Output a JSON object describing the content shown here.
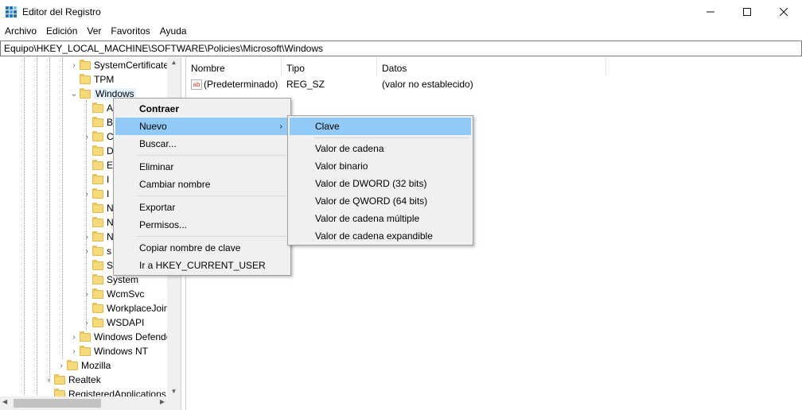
{
  "window": {
    "title": "Editor del Registro",
    "minimize_icon": "minimize-icon",
    "maximize_icon": "maximize-icon",
    "close_icon": "close-icon"
  },
  "menu": [
    "Archivo",
    "Edición",
    "Ver",
    "Favoritos",
    "Ayuda"
  ],
  "address": "Equipo\\HKEY_LOCAL_MACHINE\\SOFTWARE\\Policies\\Microsoft\\Windows",
  "tree": {
    "items": [
      {
        "label": "SystemCertificates",
        "expandable": true
      },
      {
        "label": "TPM",
        "expandable": false
      },
      {
        "label": "Windows",
        "expandable": true,
        "expanded": true,
        "selected": true
      },
      {
        "label": "A",
        "expandable": false
      },
      {
        "label": "B",
        "expandable": false
      },
      {
        "label": "C",
        "expandable": true
      },
      {
        "label": "D",
        "expandable": false
      },
      {
        "label": "E",
        "expandable": false
      },
      {
        "label": "I",
        "expandable": false
      },
      {
        "label": "I",
        "expandable": true
      },
      {
        "label": "N",
        "expandable": false
      },
      {
        "label": "N",
        "expandable": false
      },
      {
        "label": "N",
        "expandable": true
      },
      {
        "label": "s",
        "expandable": true
      },
      {
        "label": "S",
        "expandable": false
      },
      {
        "label": "System",
        "expandable": false
      },
      {
        "label": "WcmSvc",
        "expandable": true
      },
      {
        "label": "WorkplaceJoin",
        "expandable": false
      },
      {
        "label": "WSDAPI",
        "expandable": true
      },
      {
        "label": "Windows Defender",
        "expandable": true
      },
      {
        "label": "Windows NT",
        "expandable": true
      },
      {
        "label": "Mozilla",
        "expandable": true
      },
      {
        "label": "Realtek",
        "expandable": true
      },
      {
        "label": "RegisteredApplications",
        "expandable": false
      }
    ]
  },
  "list": {
    "columns": [
      "Nombre",
      "Tipo",
      "Datos"
    ],
    "rows": [
      {
        "name": "(Predeterminado)",
        "type": "REG_SZ",
        "data": "(valor no establecido)",
        "icon": "ab"
      }
    ]
  },
  "context_menu": {
    "items": [
      "Contraer",
      "Nuevo",
      "Buscar...",
      "Eliminar",
      "Cambiar nombre",
      "Exportar",
      "Permisos...",
      "Copiar nombre de clave",
      "Ir a HKEY_CURRENT_USER"
    ],
    "arrow": "›"
  },
  "submenu": {
    "items": [
      "Clave",
      "Valor de cadena",
      "Valor binario",
      "Valor de DWORD (32 bits)",
      "Valor de QWORD (64 bits)",
      "Valor de cadena múltiple",
      "Valor de cadena expandible"
    ]
  }
}
